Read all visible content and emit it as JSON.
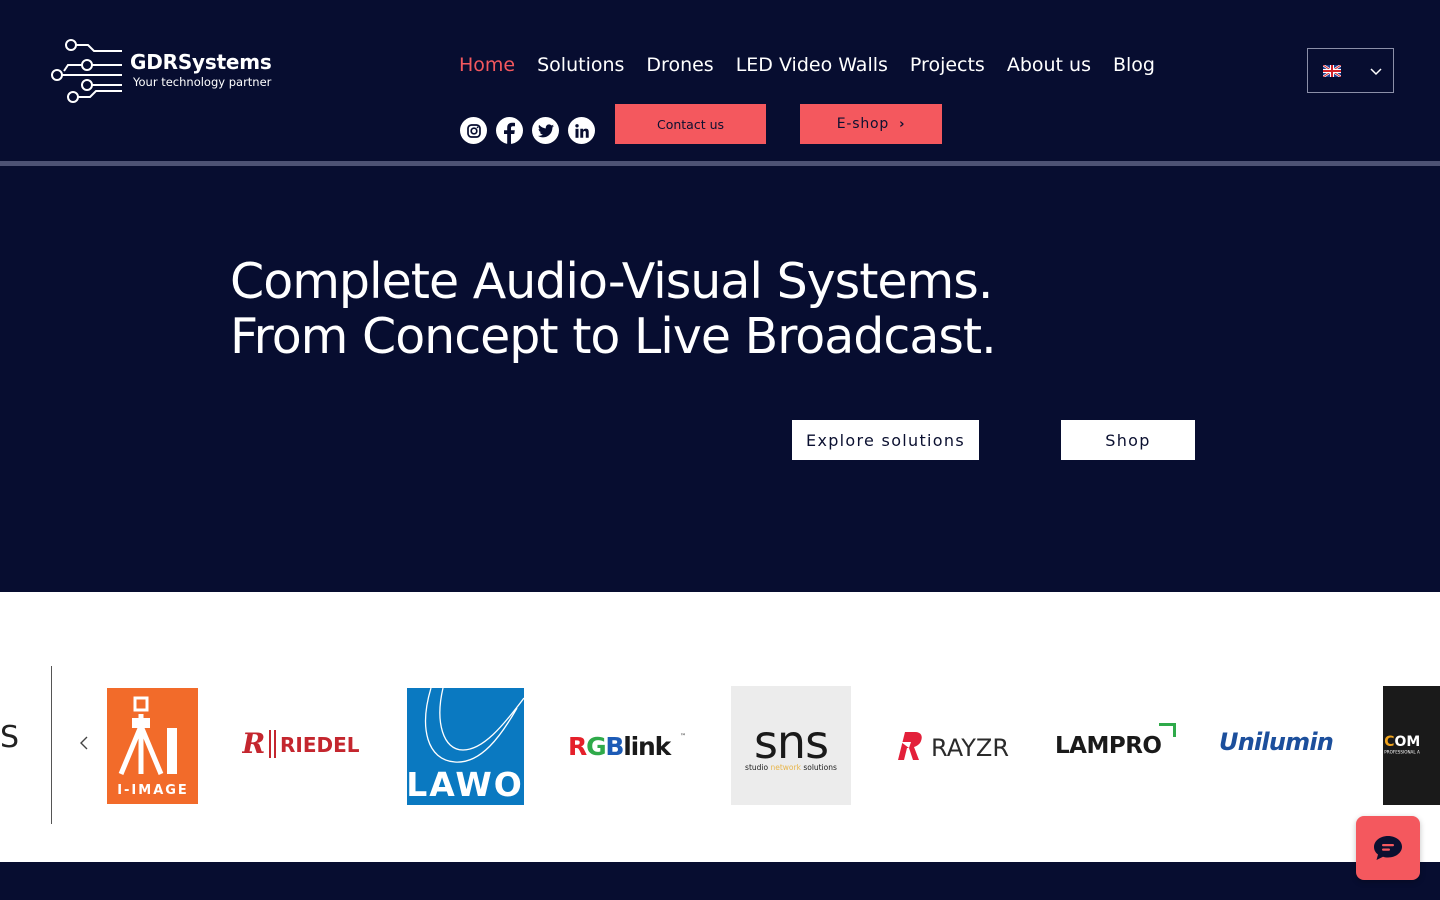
{
  "brand": {
    "name": "GDRSystems",
    "tagline": "Your technology partner"
  },
  "nav": {
    "items": [
      {
        "label": "Home",
        "active": true
      },
      {
        "label": "Solutions",
        "active": false
      },
      {
        "label": "Drones",
        "active": false
      },
      {
        "label": "LED Video Walls",
        "active": false
      },
      {
        "label": "Projects",
        "active": false
      },
      {
        "label": "About us",
        "active": false
      },
      {
        "label": "Blog",
        "active": false
      }
    ]
  },
  "language": {
    "selected": "English",
    "icon": "uk-flag-icon"
  },
  "social": [
    "instagram-icon",
    "facebook-icon",
    "twitter-icon",
    "linkedin-icon"
  ],
  "header_buttons": {
    "contact": "Contact us",
    "eshop": "E-shop"
  },
  "hero": {
    "title": "Complete Audio-Visual Systems. From Concept to Live Broadcast.",
    "explore": "Explore solutions",
    "shop": "Shop"
  },
  "partners": {
    "edge_text": "S",
    "logos": [
      {
        "name": "I-IMAGE",
        "text": "I-IMAGE"
      },
      {
        "name": "RIEDEL",
        "text": "RIEDEL"
      },
      {
        "name": "LAWO",
        "text": "LAWO"
      },
      {
        "name": "RGBlink",
        "text": "RGBlink"
      },
      {
        "name": "sns",
        "text": "sns",
        "subtext_pre": "studio ",
        "subtext_mid": "network",
        "subtext_post": " solutions"
      },
      {
        "name": "RAYZR",
        "text": "RAYZR"
      },
      {
        "name": "LAMPRO",
        "text": "LAMPRO"
      },
      {
        "name": "Unilumin",
        "text": "Unilumin"
      },
      {
        "name": "COM",
        "text": "COM",
        "subtext": "PROFESSIONAL A"
      }
    ]
  },
  "colors": {
    "background": "#070d30",
    "accent": "#f4585e",
    "white": "#ffffff"
  }
}
